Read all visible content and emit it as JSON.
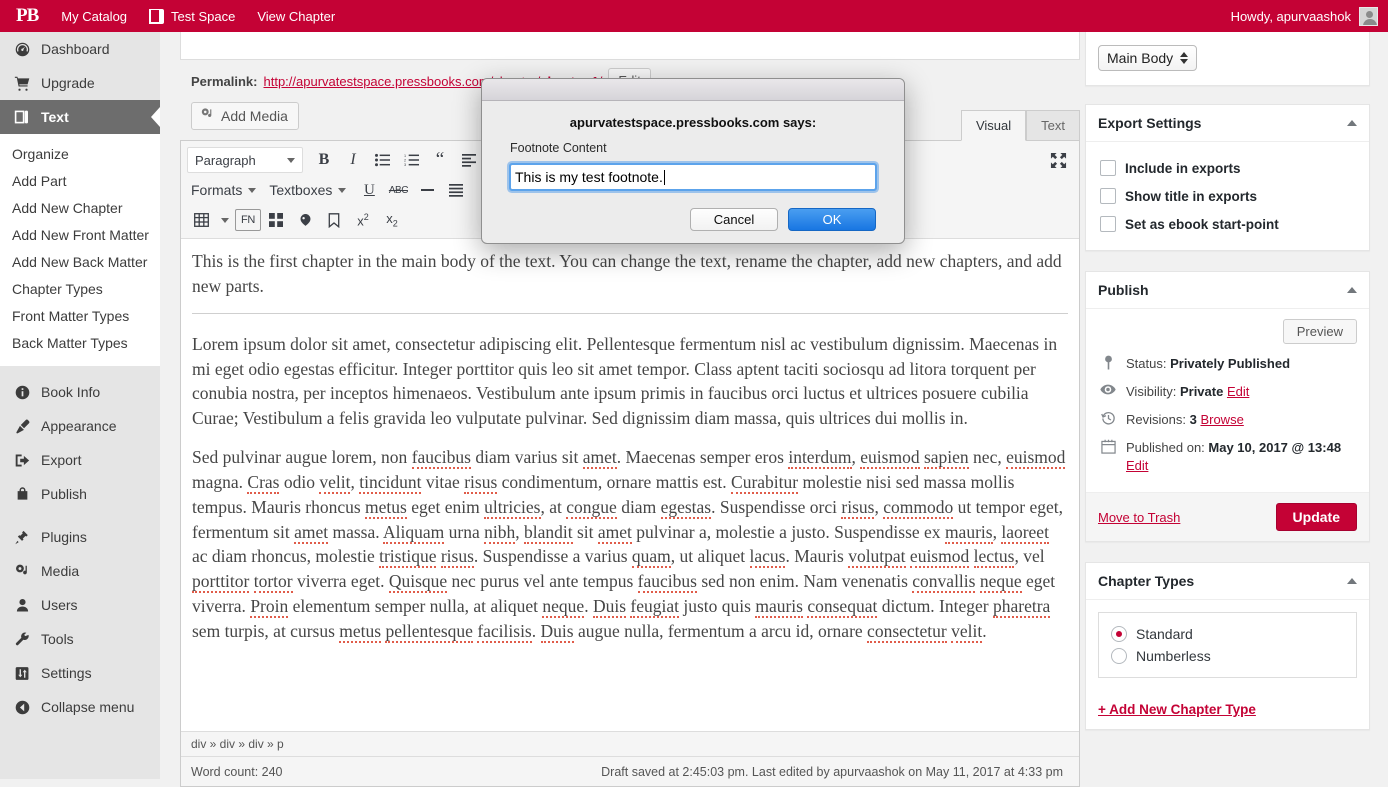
{
  "adminbar": {
    "logo": "PB",
    "items": [
      {
        "label": "My Catalog",
        "icon": "none"
      },
      {
        "label": "Test Space",
        "icon": "book-icon"
      },
      {
        "label": "View Chapter",
        "icon": "none"
      }
    ],
    "howdy": "Howdy, apurvaashok"
  },
  "sidebar": {
    "items": [
      {
        "label": "Dashboard",
        "icon": "dashboard-icon"
      },
      {
        "label": "Upgrade",
        "icon": "cart-icon"
      },
      {
        "label": "Text",
        "icon": "book-icon",
        "active": true
      }
    ],
    "submenu": [
      {
        "label": "Organize"
      },
      {
        "label": "Add Part"
      },
      {
        "label": "Add New Chapter"
      },
      {
        "label": "Add New Front Matter"
      },
      {
        "label": "Add New Back Matter"
      },
      {
        "label": "Chapter Types"
      },
      {
        "label": "Front Matter Types"
      },
      {
        "label": "Back Matter Types"
      }
    ],
    "items2": [
      {
        "label": "Book Info",
        "icon": "info-icon"
      },
      {
        "label": "Appearance",
        "icon": "brush-icon"
      },
      {
        "label": "Export",
        "icon": "export-icon"
      },
      {
        "label": "Publish",
        "icon": "bag-icon"
      }
    ],
    "items3": [
      {
        "label": "Plugins",
        "icon": "plug-icon"
      },
      {
        "label": "Media",
        "icon": "media-icon"
      },
      {
        "label": "Users",
        "icon": "user-icon"
      },
      {
        "label": "Tools",
        "icon": "wrench-icon"
      },
      {
        "label": "Settings",
        "icon": "sliders-icon"
      },
      {
        "label": "Collapse menu",
        "icon": "collapse-icon"
      }
    ]
  },
  "editor": {
    "permalink_label": "Permalink:",
    "permalink_url": "http://apurvatestspace.pressbooks.com/chapter/",
    "permalink_slug": "chapter-1",
    "permalink_tail": "/",
    "edit_button": "Edit",
    "add_media": "Add Media",
    "tabs": [
      {
        "label": "Visual",
        "active": true
      },
      {
        "label": "Text",
        "active": false
      }
    ],
    "toolbar": {
      "paragraph_select": "Paragraph",
      "formats_label": "Formats",
      "textboxes_label": "Textboxes",
      "footnote_label": "FN",
      "icons_row1": [
        "bold-icon",
        "italic-icon",
        "bullet-list-icon",
        "numbered-list-icon",
        "blockquote-icon",
        "align-left-icon"
      ],
      "icons_row2": [
        "underline-icon",
        "strikethrough-icon",
        "horizontal-rule-icon",
        "align-justify-icon"
      ],
      "icons_row3": [
        "table-icon",
        "table-dropdown-icon",
        "footnote-icon",
        "glossary-icon",
        "anchor-icon",
        "bookmark-icon",
        "superscript-icon",
        "subscript-icon"
      ],
      "fullscreen_icon": "fullscreen-icon"
    },
    "content": {
      "intro": "This is the first chapter in the main body of the text. You can change the text, rename the chapter, add new chapters, and add new parts.",
      "para1": "Lorem ipsum dolor sit amet, consectetur adipiscing elit. Pellentesque fermentum nisl ac vestibulum dignissim. Maecenas in mi eget odio egestas efficitur. Integer porttitor quis leo sit amet tempor. Class aptent taciti sociosqu ad litora torquent per conubia nostra, per inceptos himenaeos. Vestibulum ante ipsum primis in faucibus orci luctus et ultrices posuere cubilia Curae; Vestibulum a felis gravida leo vulputate pulvinar. Sed dignissim diam massa, quis ultrices dui mollis in.",
      "para2": "Sed pulvinar augue lorem, non faucibus diam varius sit amet. Maecenas semper eros interdum, euismod sapien nec, euismod magna. Cras odio velit, tincidunt vitae risus condimentum, ornare mattis est. Curabitur molestie nisi sed massa mollis tempus. Mauris rhoncus metus eget enim ultricies, at congue diam egestas. Suspendisse orci risus, commodo ut tempor eget, fermentum sit amet massa. Aliquam urna nibh, blandit sit amet pulvinar a, molestie a justo. Suspendisse ex mauris, laoreet ac diam rhoncus, molestie tristique risus. Suspendisse a varius quam, ut aliquet lacus. Mauris volutpat euismod lectus, vel porttitor tortor viverra eget. Quisque nec purus vel ante tempus faucibus sed non enim. Nam venenatis convallis neque eget viverra. Proin elementum semper nulla, at aliquet neque. Duis feugiat justo quis mauris consequat dictum. Integer pharetra sem turpis, at cursus metus pellentesque facilisis. Duis augue nulla, fermentum a arcu id, ornare consectetur velit."
    },
    "statusbar": {
      "path": "div » div » div » p",
      "word_count": "Word count: 240",
      "saved_info": "Draft saved at 2:45:03 pm. Last edited by apurvaashok on May 11, 2017 at 4:33 pm"
    }
  },
  "rightcol": {
    "part_select": "Main Body",
    "export": {
      "title": "Export Settings",
      "options": [
        {
          "label": "Include in exports",
          "checked": false
        },
        {
          "label": "Show title in exports",
          "checked": false
        },
        {
          "label": "Set as ebook start-point",
          "checked": false
        }
      ]
    },
    "publish": {
      "title": "Publish",
      "preview_label": "Preview",
      "status_label": "Status:",
      "status_value": "Privately Published",
      "visibility_label": "Visibility:",
      "visibility_value": "Private",
      "visibility_edit": "Edit",
      "revisions_label": "Revisions:",
      "revisions_value": "3",
      "revisions_browse": "Browse",
      "published_label": "Published on:",
      "published_value": "May 10, 2017 @ 13:48",
      "published_edit": "Edit",
      "trash_label": "Move to Trash",
      "update_label": "Update"
    },
    "chapter_types": {
      "title": "Chapter Types",
      "options": [
        {
          "label": "Standard",
          "selected": true
        },
        {
          "label": "Numberless",
          "selected": false
        }
      ],
      "add_link": "+ Add New Chapter Type"
    }
  },
  "modal": {
    "says": "apurvatestspace.pressbooks.com says:",
    "prompt_label": "Footnote Content",
    "input_value": "This is my test footnote.",
    "cancel_label": "Cancel",
    "ok_label": "OK"
  },
  "colors": {
    "brand": "#c40235",
    "sidebar_bg": "#e5e5e5",
    "active_menu": "#6d6d6d",
    "ok_button": "#1876e2"
  }
}
